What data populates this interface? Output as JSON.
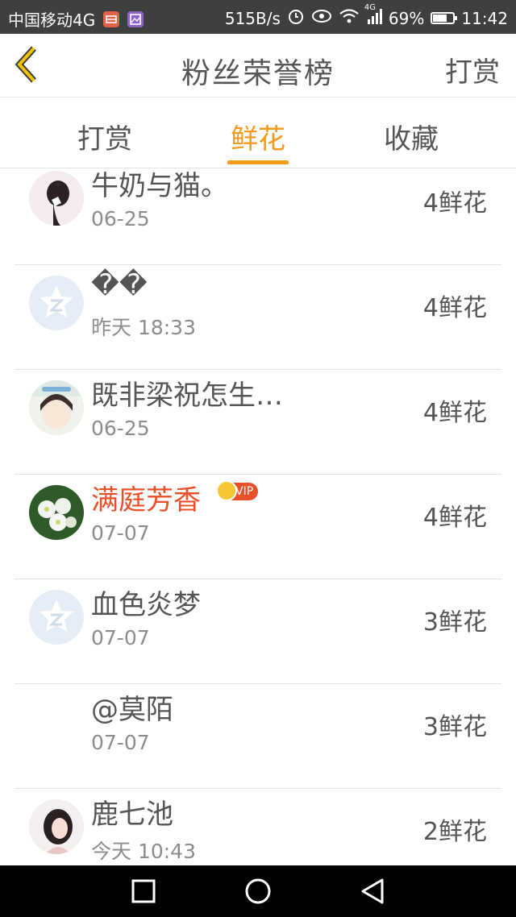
{
  "status_bar": {
    "carrier": "中国移动4G",
    "speed": "515B/s",
    "network_type": "4G",
    "battery": "69%",
    "battery_level": 0.69,
    "time": "11:42"
  },
  "header": {
    "title": "粉丝荣誉榜",
    "right_action": "打赏"
  },
  "tabs": [
    {
      "label": "打赏",
      "active": false
    },
    {
      "label": "鲜花",
      "active": true
    },
    {
      "label": "收藏",
      "active": false
    }
  ],
  "accent_color": "#f59a1b",
  "vip_name_color": "#e8502a",
  "fans": [
    {
      "name": "牛奶与猫。",
      "date": "06-25",
      "amount": "4鲜花",
      "avatar": "girl-photo",
      "vip": false
    },
    {
      "name": "��",
      "date": "昨天 18:33",
      "amount": "4鲜花",
      "avatar": "default-qq-icon",
      "vip": false
    },
    {
      "name": "既非梁祝怎生…",
      "date": "06-25",
      "amount": "4鲜花",
      "avatar": "cartoon-girl-photo",
      "vip": false
    },
    {
      "name": "满庭芳香",
      "date": "07-07",
      "amount": "4鲜花",
      "avatar": "flower-photo",
      "vip": true,
      "badge": "VIP"
    },
    {
      "name": "血色炎梦",
      "date": "07-07",
      "amount": "3鲜花",
      "avatar": "default-qq-icon",
      "vip": false
    },
    {
      "name": "@莫陌",
      "date": "07-07",
      "amount": "3鲜花",
      "avatar": "none",
      "vip": false
    },
    {
      "name": "鹿七池",
      "date": "今天 10:43",
      "amount": "2鲜花",
      "avatar": "girl-photo",
      "vip": false
    }
  ]
}
